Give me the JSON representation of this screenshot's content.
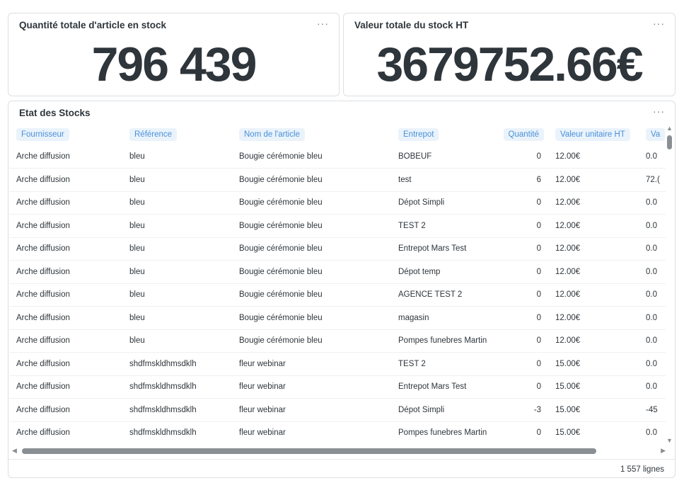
{
  "kpi_quantity": {
    "title": "Quantité totale d'article en stock",
    "value": "796 439",
    "menu": "···"
  },
  "kpi_value": {
    "title": "Valeur totale du stock HT",
    "value": "3679752.66€",
    "menu": "···"
  },
  "stock_table": {
    "title": "Etat des Stocks",
    "menu": "···",
    "columns": [
      "Fournisseur",
      "Référence",
      "Nom de l'article",
      "Entrepot",
      "Quantité",
      "Valeur unitaire HT",
      "Va"
    ],
    "rows": [
      [
        "Arche diffusion",
        "bleu",
        "Bougie cérémonie bleu",
        "BOBEUF",
        "0",
        "12.00€",
        "0.0"
      ],
      [
        "Arche diffusion",
        "bleu",
        "Bougie cérémonie bleu",
        "test",
        "6",
        "12.00€",
        "72.("
      ],
      [
        "Arche diffusion",
        "bleu",
        "Bougie cérémonie bleu",
        "Dépot Simpli",
        "0",
        "12.00€",
        "0.0"
      ],
      [
        "Arche diffusion",
        "bleu",
        "Bougie cérémonie bleu",
        "TEST 2",
        "0",
        "12.00€",
        "0.0"
      ],
      [
        "Arche diffusion",
        "bleu",
        "Bougie cérémonie bleu",
        "Entrepot Mars Test",
        "0",
        "12.00€",
        "0.0"
      ],
      [
        "Arche diffusion",
        "bleu",
        "Bougie cérémonie bleu",
        "Dépot temp",
        "0",
        "12.00€",
        "0.0"
      ],
      [
        "Arche diffusion",
        "bleu",
        "Bougie cérémonie bleu",
        "AGENCE TEST 2",
        "0",
        "12.00€",
        "0.0"
      ],
      [
        "Arche diffusion",
        "bleu",
        "Bougie cérémonie bleu",
        "magasin",
        "0",
        "12.00€",
        "0.0"
      ],
      [
        "Arche diffusion",
        "bleu",
        "Bougie cérémonie bleu",
        "Pompes funebres Martin",
        "0",
        "12.00€",
        "0.0"
      ],
      [
        "Arche diffusion",
        "shdfmskldhmsdklh",
        "fleur webinar",
        "TEST 2",
        "0",
        "15.00€",
        "0.0"
      ],
      [
        "Arche diffusion",
        "shdfmskldhmsdklh",
        "fleur webinar",
        "Entrepot Mars Test",
        "0",
        "15.00€",
        "0.0"
      ],
      [
        "Arche diffusion",
        "shdfmskldhmsdklh",
        "fleur webinar",
        "Dépot Simpli",
        "-3",
        "15.00€",
        "-45"
      ],
      [
        "Arche diffusion",
        "shdfmskldhmsdklh",
        "fleur webinar",
        "Pompes funebres Martin",
        "0",
        "15.00€",
        "0.0"
      ]
    ],
    "row_count": "1 557 lignes"
  },
  "colors": {
    "header_pill_bg": "#eaf3fb",
    "header_pill_text": "#4a90d9",
    "text": "#2e353b",
    "scrollbar": "#8a8f94"
  },
  "icons": {
    "card_menu": "ellipsis-icon",
    "scroll_up": "triangle-up-icon",
    "scroll_down": "triangle-down-icon",
    "scroll_left": "triangle-left-icon",
    "scroll_right": "triangle-right-icon"
  }
}
